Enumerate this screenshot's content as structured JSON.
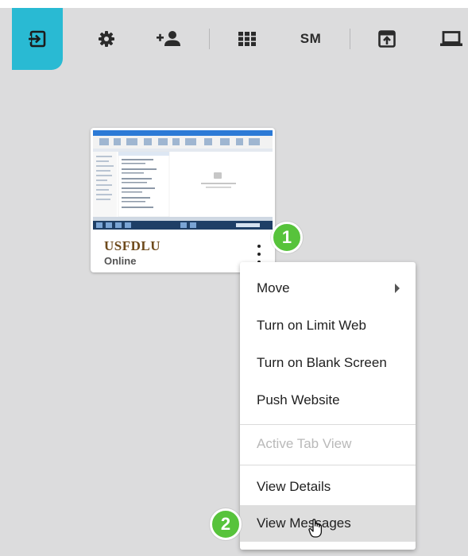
{
  "toolbar": {
    "items": [
      {
        "icon": "sign-in-icon"
      },
      {
        "icon": "gear-icon"
      },
      {
        "icon": "add-user-icon"
      },
      {
        "icon": "grid-icon"
      },
      {
        "label": "SM"
      },
      {
        "icon": "upload-window-icon"
      },
      {
        "icon": "laptop-icon"
      }
    ],
    "accent_color": "#29bad3"
  },
  "device_card": {
    "name": "USFDLU",
    "status": "Online",
    "name_color": "#6e4a1c"
  },
  "badges": {
    "step1": "1",
    "step2": "2",
    "color": "#57c33b"
  },
  "context_menu": {
    "items": [
      {
        "label": "Move",
        "submenu": true
      },
      {
        "label": "Turn on Limit Web"
      },
      {
        "label": "Turn on Blank Screen"
      },
      {
        "label": "Push Website"
      },
      {
        "label": "Active Tab View",
        "disabled": true
      },
      {
        "label": "View Details"
      },
      {
        "label": "View Messages",
        "hovered": true
      }
    ]
  }
}
